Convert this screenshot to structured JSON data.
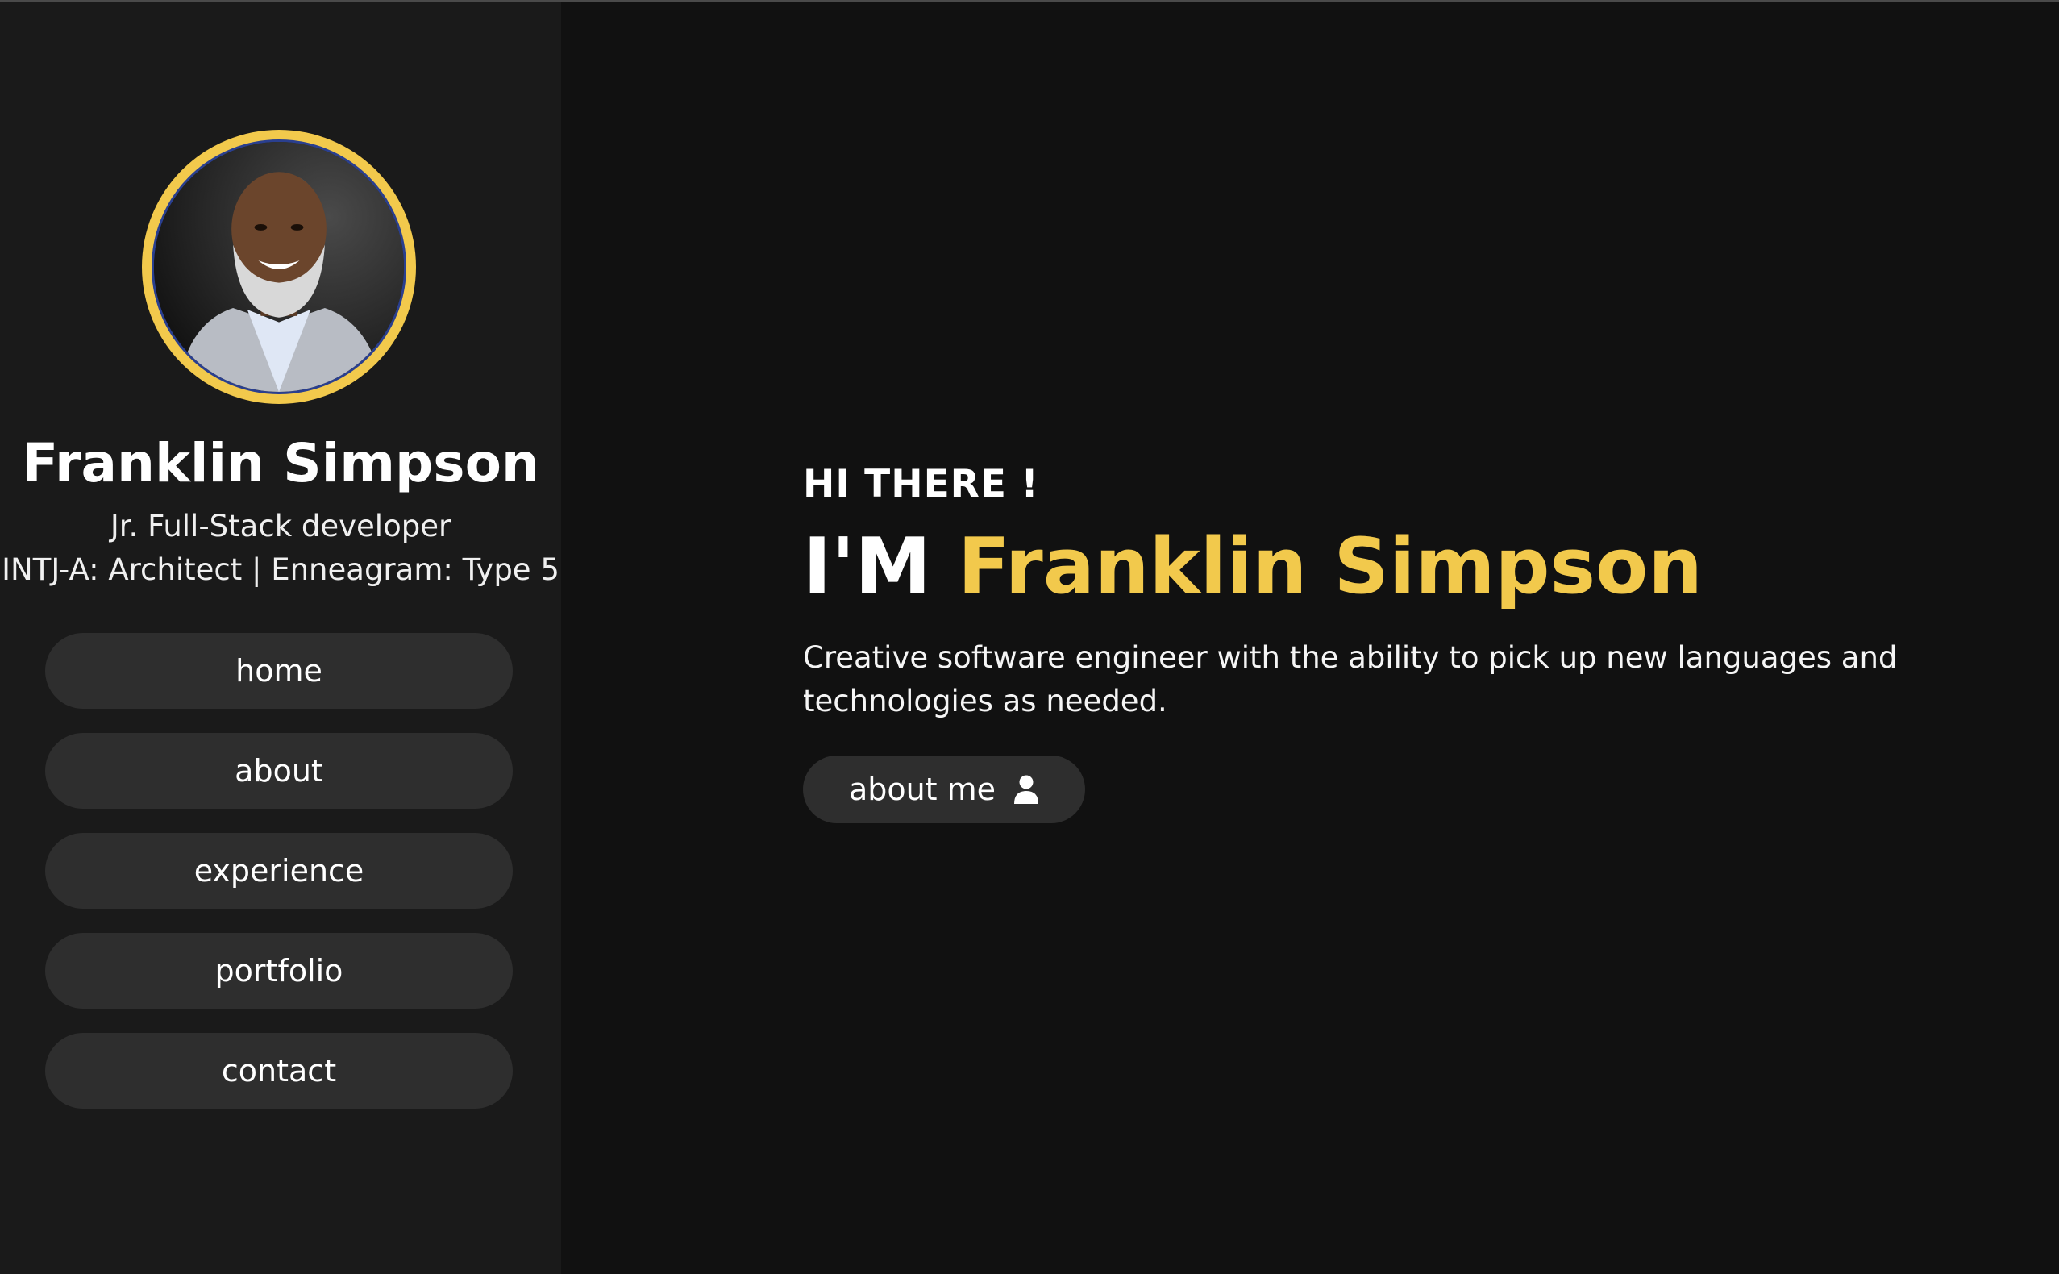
{
  "colors": {
    "background": "#111111",
    "sidebar": "#1a1a1a",
    "button": "#2e2e2e",
    "accent": "#f2c94c",
    "text": "#ffffff"
  },
  "sidebar": {
    "profile": {
      "name": "Franklin Simpson",
      "title": "Jr. Full-Stack developer",
      "personality": "INTJ-A: Architect | Enneagram: Type 5"
    },
    "nav": [
      {
        "label": "home"
      },
      {
        "label": "about"
      },
      {
        "label": "experience"
      },
      {
        "label": "portfolio"
      },
      {
        "label": "contact"
      }
    ]
  },
  "hero": {
    "greeting": "HI THERE !",
    "headline_prefix": "I'M",
    "headline_name": "Franklin Simpson",
    "description": "Creative software engineer with the ability to pick up new languages and technologies as needed.",
    "cta": {
      "label": "about me",
      "icon": "user-icon"
    }
  }
}
